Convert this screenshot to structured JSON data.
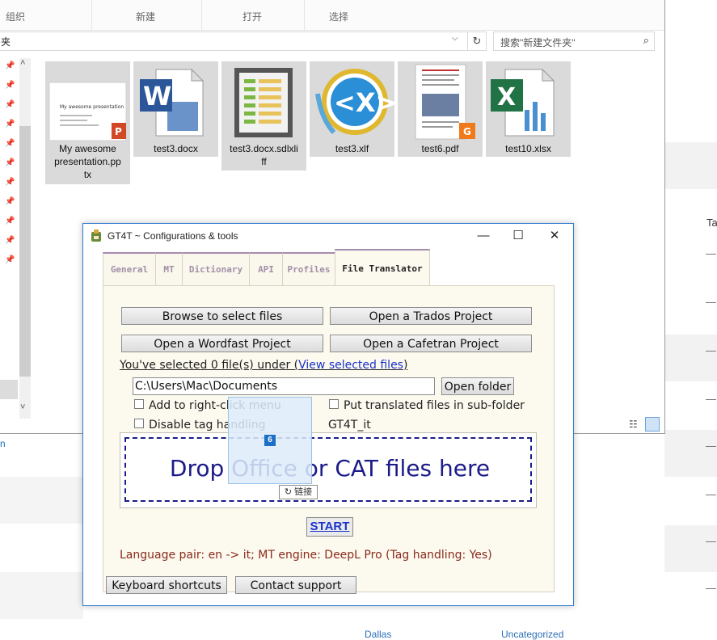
{
  "explorer": {
    "ribbon": {
      "organize_label": "组织",
      "new_label": "新建",
      "open_label": "打开",
      "select_label": "选择"
    },
    "address": {
      "text": "夹"
    },
    "search": {
      "placeholder": "搜索\"新建文件夹\""
    },
    "files": [
      {
        "name": "My awesome presentation.pptx",
        "line1": "My awesome",
        "line2": "presentation.pp",
        "line3": "tx",
        "icon": "pptx-thumbnail",
        "thumb_title": "My awesome presentation"
      },
      {
        "name": "test3.docx",
        "line1": "test3.docx",
        "icon": "word-icon"
      },
      {
        "name": "test3.docx.sdlxliff",
        "line1": "test3.docx.sdlxli",
        "line2": "ff",
        "icon": "sdlxliff-icon"
      },
      {
        "name": "test3.xlf",
        "line1": "test3.xlf",
        "icon": "xlf-icon"
      },
      {
        "name": "test6.pdf",
        "line1": "test6.pdf",
        "icon": "pdf-thumbnail"
      },
      {
        "name": "test10.xlsx",
        "line1": "test10.xlsx",
        "icon": "excel-icon"
      }
    ]
  },
  "background": {
    "col_header": "Ta",
    "dash": "—",
    "left_link": "n",
    "bottom_link_1": "Dallas",
    "bottom_link_2": "Uncategorized"
  },
  "gt4t": {
    "title": "GT4T ~ Configurations & tools",
    "window_buttons": {
      "minimize": "—",
      "maximize": "☐",
      "close": "✕"
    },
    "tabs": [
      {
        "label": "General",
        "active": false
      },
      {
        "label": "MT",
        "active": false
      },
      {
        "label": "Dictionary",
        "active": false
      },
      {
        "label": "API",
        "active": false
      },
      {
        "label": "Profiles",
        "active": false
      },
      {
        "label": "File Translator",
        "active": true
      }
    ],
    "buttons": {
      "browse": "Browse to select files",
      "trados": "Open a Trados Project",
      "wordfast": "Open a Wordfast Project",
      "cafetran": "Open a Cafetran Project",
      "open_folder": "Open folder",
      "start": "START",
      "keyboard": "Keyboard shortcuts",
      "contact": "Contact support"
    },
    "selection_text": "You've selected 0 file(s) under (",
    "selection_link": "View selected files",
    "selection_close": ")",
    "path": "C:\\Users\\Mac\\Documents",
    "checkboxes": {
      "right_click": "Add to right-click menu",
      "subfolder": "Put translated files in sub-folder",
      "disable_tag": "Disable tag handling",
      "subfolder_name": "GT4T_it"
    },
    "drop_text": "Drop Office or CAT files here",
    "drag_count": "6",
    "drag_tooltip": "链接",
    "language_pair": "Language pair: en -> it; MT engine: DeepL Pro (Tag handling: Yes)"
  }
}
